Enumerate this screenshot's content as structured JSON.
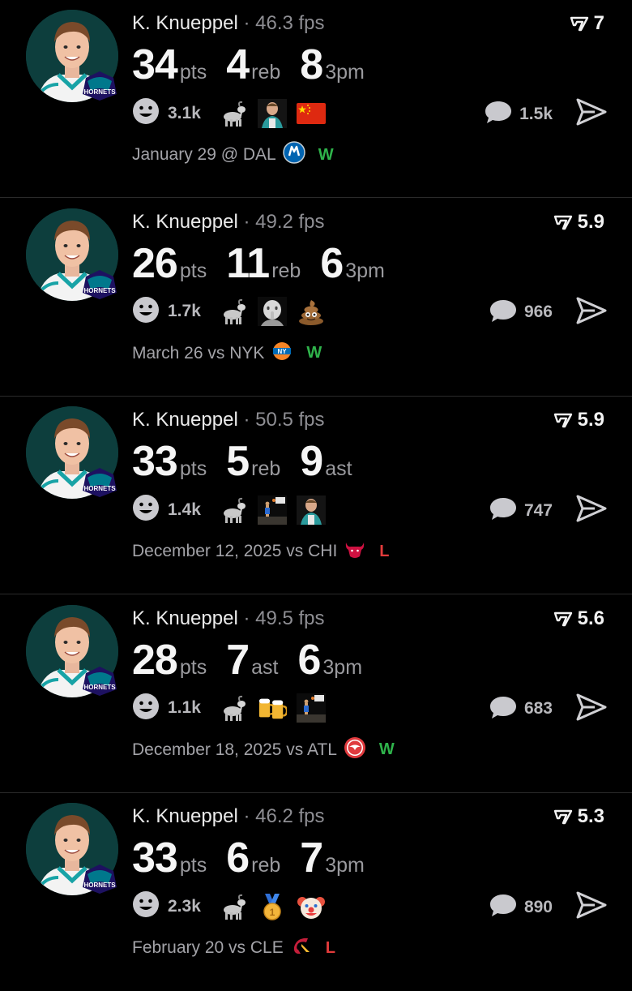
{
  "posts": [
    {
      "player": "K. Knueppel",
      "separator": "·",
      "fps": "46.3 fps",
      "rating": "7",
      "stats": [
        {
          "value": "34",
          "unit": "pts"
        },
        {
          "value": "4",
          "unit": "reb"
        },
        {
          "value": "8",
          "unit": "3pm"
        }
      ],
      "reaction_count": "3.1k",
      "reaction_icons": [
        "goat-emoji",
        "player-photo-emoji",
        "china-flag-emoji"
      ],
      "comment_count": "1.5k",
      "date": "January 29 @ DAL",
      "opponent_logo": "mavericks-logo",
      "result": "W"
    },
    {
      "player": "K. Knueppel",
      "separator": "·",
      "fps": "49.2 fps",
      "rating": "5.9",
      "stats": [
        {
          "value": "26",
          "unit": "pts"
        },
        {
          "value": "11",
          "unit": "reb"
        },
        {
          "value": "6",
          "unit": "3pm"
        }
      ],
      "reaction_count": "1.7k",
      "reaction_icons": [
        "goat-emoji",
        "shushing-face-emoji",
        "poop-emoji"
      ],
      "comment_count": "966",
      "date": "March 26 vs NYK",
      "opponent_logo": "knicks-logo",
      "result": "W"
    },
    {
      "player": "K. Knueppel",
      "separator": "·",
      "fps": "50.5 fps",
      "rating": "5.9",
      "stats": [
        {
          "value": "33",
          "unit": "pts"
        },
        {
          "value": "5",
          "unit": "reb"
        },
        {
          "value": "9",
          "unit": "ast"
        }
      ],
      "reaction_count": "1.4k",
      "reaction_icons": [
        "goat-emoji",
        "basketball-shot-emoji",
        "player-photo-emoji"
      ],
      "comment_count": "747",
      "date": "December 12, 2025 vs CHI",
      "opponent_logo": "bulls-logo",
      "result": "L"
    },
    {
      "player": "K. Knueppel",
      "separator": "·",
      "fps": "49.5 fps",
      "rating": "5.6",
      "stats": [
        {
          "value": "28",
          "unit": "pts"
        },
        {
          "value": "7",
          "unit": "ast"
        },
        {
          "value": "6",
          "unit": "3pm"
        }
      ],
      "reaction_count": "1.1k",
      "reaction_icons": [
        "goat-emoji",
        "beer-mugs-emoji",
        "basketball-shot-emoji"
      ],
      "comment_count": "683",
      "date": "December 18, 2025 vs ATL",
      "opponent_logo": "hawks-logo",
      "result": "W"
    },
    {
      "player": "K. Knueppel",
      "separator": "·",
      "fps": "46.2 fps",
      "rating": "5.3",
      "stats": [
        {
          "value": "33",
          "unit": "pts"
        },
        {
          "value": "6",
          "unit": "reb"
        },
        {
          "value": "7",
          "unit": "3pm"
        }
      ],
      "reaction_count": "2.3k",
      "reaction_icons": [
        "goat-emoji",
        "gold-medal-emoji",
        "clown-face-emoji"
      ],
      "comment_count": "890",
      "date": "February 20 vs CLE",
      "opponent_logo": "cavaliers-logo",
      "result": "L"
    }
  ],
  "colors": {
    "background": "#000000",
    "win": "#2fb34b",
    "loss": "#e23b3b",
    "muted": "#8e8e93",
    "avatar_bg": "#0d3e3d"
  }
}
